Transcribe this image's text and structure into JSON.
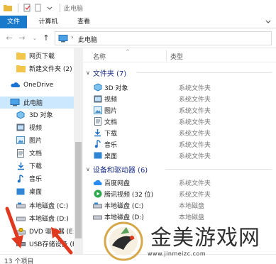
{
  "window": {
    "title": "此电脑"
  },
  "ribbon": {
    "tabs": [
      {
        "label": "文件",
        "active": true
      },
      {
        "label": "计算机",
        "active": false
      },
      {
        "label": "查看",
        "active": false
      }
    ]
  },
  "address": {
    "path": "此电脑"
  },
  "nav": {
    "items": [
      {
        "label": "网页下载",
        "icon": "folder-icon"
      },
      {
        "label": "新建文件夹 (2)",
        "icon": "folder-icon"
      },
      {
        "label": "OneDrive",
        "icon": "onedrive-icon"
      },
      {
        "label": "此电脑",
        "icon": "this-pc-icon",
        "selected": true
      },
      {
        "label": "3D 对象",
        "icon": "3d-objects-icon"
      },
      {
        "label": "视频",
        "icon": "video-icon"
      },
      {
        "label": "图片",
        "icon": "pictures-icon"
      },
      {
        "label": "文档",
        "icon": "documents-icon"
      },
      {
        "label": "下载",
        "icon": "downloads-icon"
      },
      {
        "label": "音乐",
        "icon": "music-icon"
      },
      {
        "label": "桌面",
        "icon": "desktop-icon"
      },
      {
        "label": "本地磁盘 (C:)",
        "icon": "drive-icon"
      },
      {
        "label": "本地磁盘 (D:)",
        "icon": "drive-icon"
      },
      {
        "label": "DVD 驱动器 (E:)",
        "icon": "dvd-drive-icon"
      },
      {
        "label": "USB存储设备 (F",
        "icon": "usb-drive-icon"
      }
    ]
  },
  "columns": {
    "name": "名称",
    "type": "类型"
  },
  "groups": {
    "folders": {
      "title": "文件夹 (7)",
      "rows": [
        {
          "name": "3D 对象",
          "type": "系统文件夹",
          "icon": "3d-objects-icon"
        },
        {
          "name": "视频",
          "type": "系统文件夹",
          "icon": "video-icon"
        },
        {
          "name": "图片",
          "type": "系统文件夹",
          "icon": "pictures-icon"
        },
        {
          "name": "文档",
          "type": "系统文件夹",
          "icon": "documents-icon"
        },
        {
          "name": "下载",
          "type": "系统文件夹",
          "icon": "downloads-icon"
        },
        {
          "name": "音乐",
          "type": "系统文件夹",
          "icon": "music-icon"
        },
        {
          "name": "桌面",
          "type": "系统文件夹",
          "icon": "desktop-icon"
        }
      ]
    },
    "devices": {
      "title": "设备和驱动器 (6)",
      "rows": [
        {
          "name": "百度网盘",
          "type": "系统文件夹",
          "icon": "baidu-netdisk-icon"
        },
        {
          "name": "腾讯视频 (32 位)",
          "type": "系统文件夹",
          "icon": "tencent-video-icon"
        },
        {
          "name": "本地磁盘 (C:)",
          "type": "本地磁盘",
          "icon": "drive-icon"
        },
        {
          "name": "本地磁盘 (D:)",
          "type": "本地磁盘",
          "icon": "drive-icon"
        }
      ]
    }
  },
  "status": {
    "items_count": "13 个项目"
  },
  "watermark": {
    "title": "金美游戏网",
    "url": "www.jinmeizc.com"
  },
  "colors": {
    "file_tab": "#1979ca",
    "selection": "#cce8ff",
    "group_title": "#1e3287",
    "annotation_arrow": "#e0391f"
  }
}
